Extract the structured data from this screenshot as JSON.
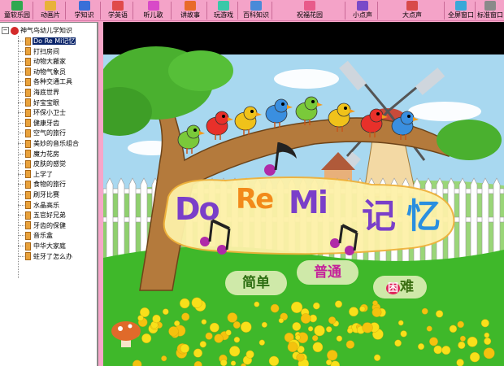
{
  "toolbar": {
    "buttons": [
      {
        "label": "童软乐园",
        "icon": "house-icon"
      },
      {
        "label": "动画片",
        "icon": "film-icon"
      },
      {
        "label": "学知识",
        "icon": "book-icon"
      },
      {
        "label": "学英语",
        "icon": "abc-icon"
      },
      {
        "label": "听儿歌",
        "icon": "music-icon"
      },
      {
        "label": "讲故事",
        "icon": "story-icon"
      },
      {
        "label": "玩游戏",
        "icon": "game-icon"
      },
      {
        "label": "百科知识",
        "icon": "globe-icon"
      },
      {
        "label": "祝福花园",
        "icon": "flower-icon"
      },
      {
        "label": "小点声",
        "icon": "volume-down-icon"
      },
      {
        "label": "大点声",
        "icon": "volume-up-icon"
      },
      {
        "label": "全屏窗口",
        "icon": "fullscreen-icon"
      },
      {
        "label": "标准窗口",
        "icon": "window-icon"
      }
    ],
    "colors": {
      "bg": "#f4a3c8"
    }
  },
  "tree": {
    "root_toggle": "−",
    "root_label": "神气鸟幼儿学知识",
    "items": [
      "Do Re Mi记忆",
      "打扫房间",
      "动物大搬家",
      "动物气象员",
      "各种交通工具",
      "海底世界",
      "好宝宝眼",
      "环保小卫士",
      "健康牙齿",
      "空气的旅行",
      "美妙的音乐组合",
      "魔力花房",
      "皮肤的感觉",
      "上学了",
      "食物的旅行",
      "刷牙比赛",
      "水晶高乐",
      "五官好兄弟",
      "牙齿的保健",
      "音乐盒",
      "中华大家庭",
      "蛀牙了怎么办"
    ],
    "selected_index": 0
  },
  "game": {
    "title_latin": [
      "Do",
      "Re",
      "Mi"
    ],
    "title_cn": [
      "记",
      "忆"
    ],
    "buttons": {
      "easy": "简单",
      "normal": "普通",
      "hard_a": "困",
      "hard_b": "难"
    },
    "colors": {
      "sky": "#a8d8f0",
      "grass": "#3fb82a",
      "title_purple": "#7a3fc9",
      "title_orange": "#f28a1a",
      "title_blue": "#2a8fe0"
    }
  }
}
